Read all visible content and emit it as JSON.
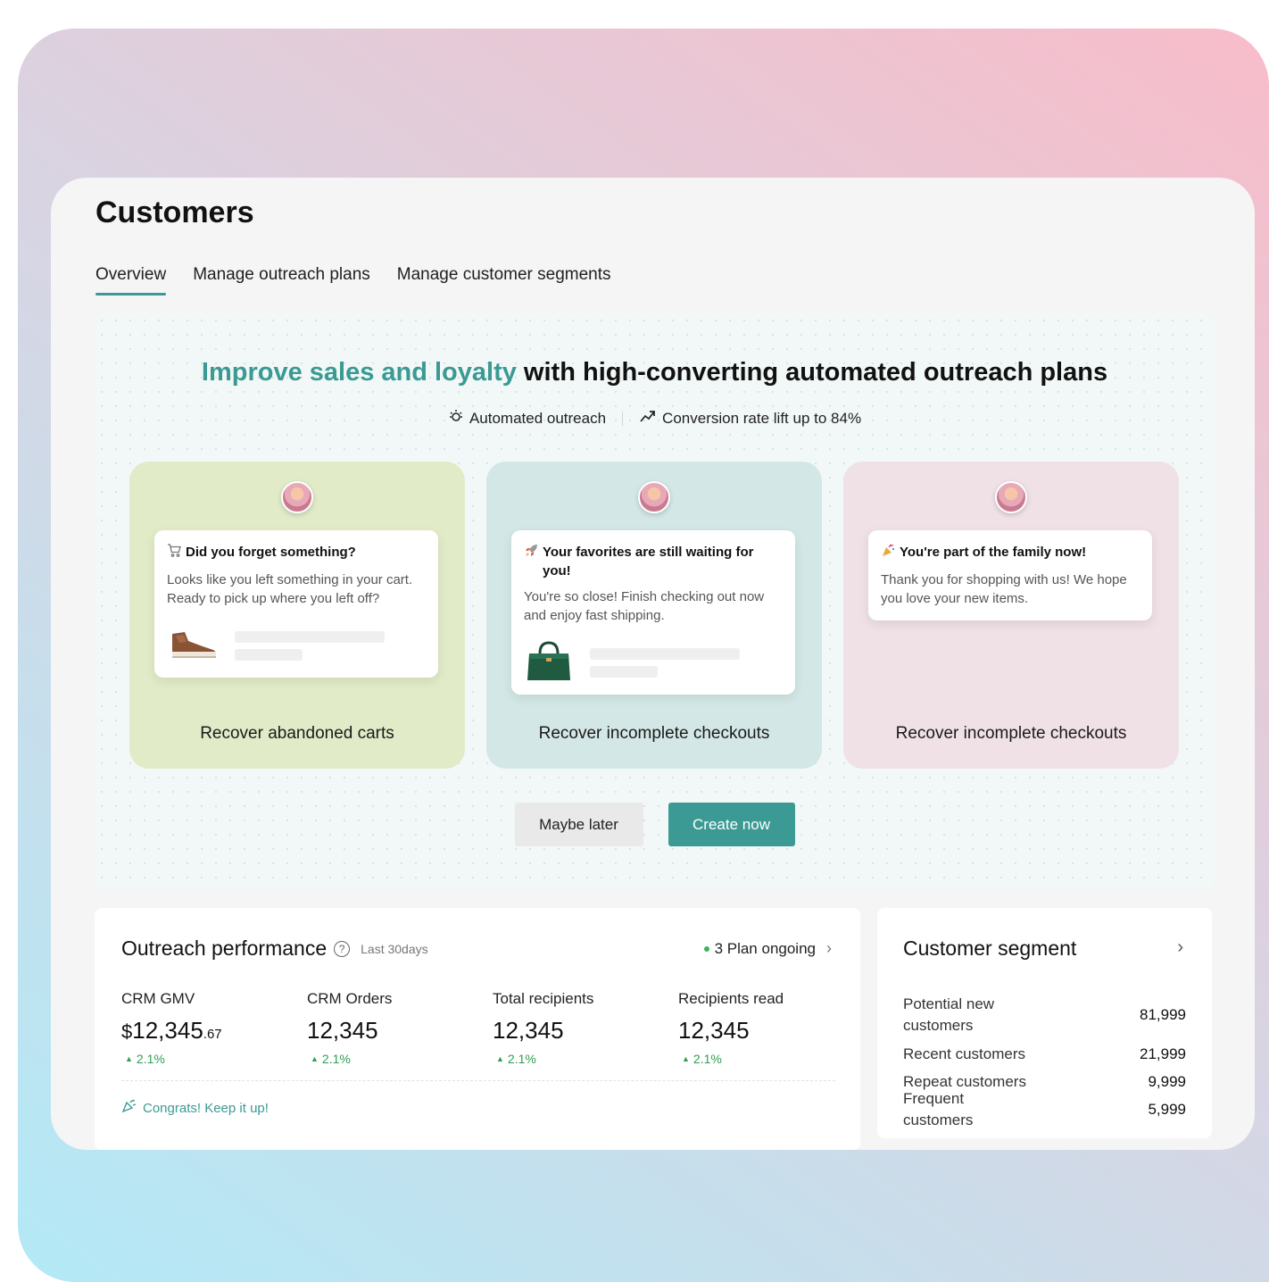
{
  "page": {
    "title": "Customers"
  },
  "tabs": [
    {
      "label": "Overview",
      "active": true
    },
    {
      "label": "Manage outreach plans",
      "active": false
    },
    {
      "label": "Manage customer segments",
      "active": false
    }
  ],
  "hero": {
    "title_accent": "Improve sales and loyalty",
    "title_rest": " with high-converting automated outreach plans",
    "features": [
      {
        "icon": "automation-icon",
        "label": "Automated outreach"
      },
      {
        "icon": "trend-up-icon",
        "label": "Conversion rate lift up to 84%"
      }
    ],
    "accent_color": "#3b9a94",
    "plans": [
      {
        "message_icon": "cart-icon",
        "message_title": "Did you forget something?",
        "message_body": "Looks like you left something in your cart. Ready to pick up where you left off?",
        "product_icon": "shoe-icon",
        "label": "Recover abandoned carts",
        "bg": "#e2ebc8"
      },
      {
        "message_icon": "rocket-icon",
        "message_title": "Your favorites are still waiting for you!",
        "message_body": "You're so close! Finish checking out now and enjoy fast shipping.",
        "product_icon": "handbag-icon",
        "label": "Recover incomplete checkouts",
        "bg": "#d3e8e6"
      },
      {
        "message_icon": "party-popper-icon",
        "message_title": "You're part of the family now!",
        "message_body": "Thank you for shopping with us! We hope you love your new items.",
        "label": "Recover incomplete checkouts",
        "bg": "#f0e1e6"
      }
    ],
    "actions": {
      "secondary": "Maybe later",
      "primary": "Create now"
    }
  },
  "performance": {
    "title": "Outreach performance",
    "range": "Last 30days",
    "status": "3 Plan ongoing",
    "metrics": [
      {
        "label": "CRM GMV",
        "currency": "$",
        "value": "12,345",
        "decimals": ".67",
        "delta": "2.1%"
      },
      {
        "label": "CRM Orders",
        "value": "12,345",
        "delta": "2.1%"
      },
      {
        "label": "Total recipients",
        "value": "12,345",
        "delta": "2.1%"
      },
      {
        "label": "Recipients read",
        "value": "12,345",
        "delta": "2.1%"
      }
    ],
    "congrats": "Congrats! Keep it up!",
    "positive_color": "#2f9e52"
  },
  "segment": {
    "title": "Customer segment",
    "rows": [
      {
        "name": "Potential new customers",
        "value": "81,999"
      },
      {
        "name": "Recent customers",
        "value": "21,999"
      },
      {
        "name": "Repeat customers",
        "value": "9,999"
      },
      {
        "name": "Frequent customers",
        "value": "5,999"
      }
    ]
  }
}
